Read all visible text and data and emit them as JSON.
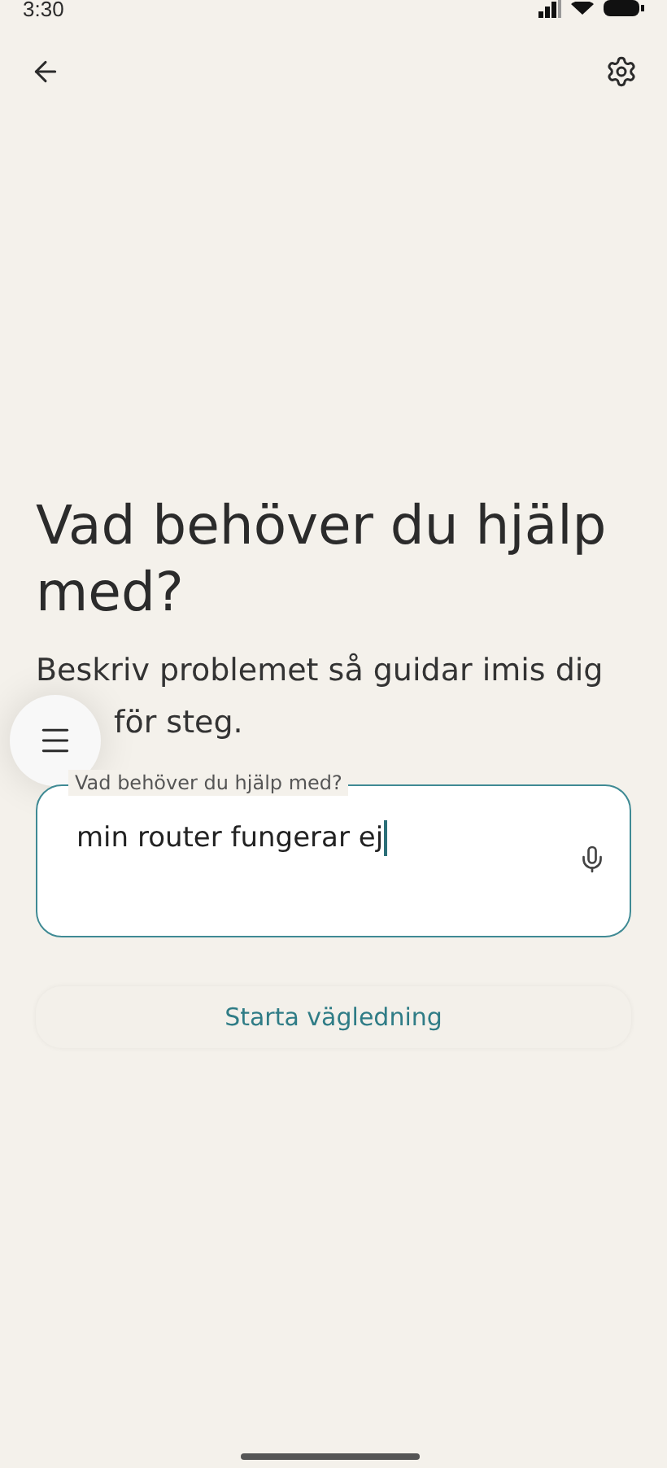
{
  "status_bar": {
    "time": "3:30"
  },
  "heading": "Vad behöver du hjälp med?",
  "subtitle_lines": [
    "Beskriv problemet så guidar imis dig",
    "för steg."
  ],
  "input": {
    "label": "Vad behöver du hjälp med?",
    "value": "min router fungerar ej",
    "focused": true
  },
  "primary_button": "Starta vägledning"
}
